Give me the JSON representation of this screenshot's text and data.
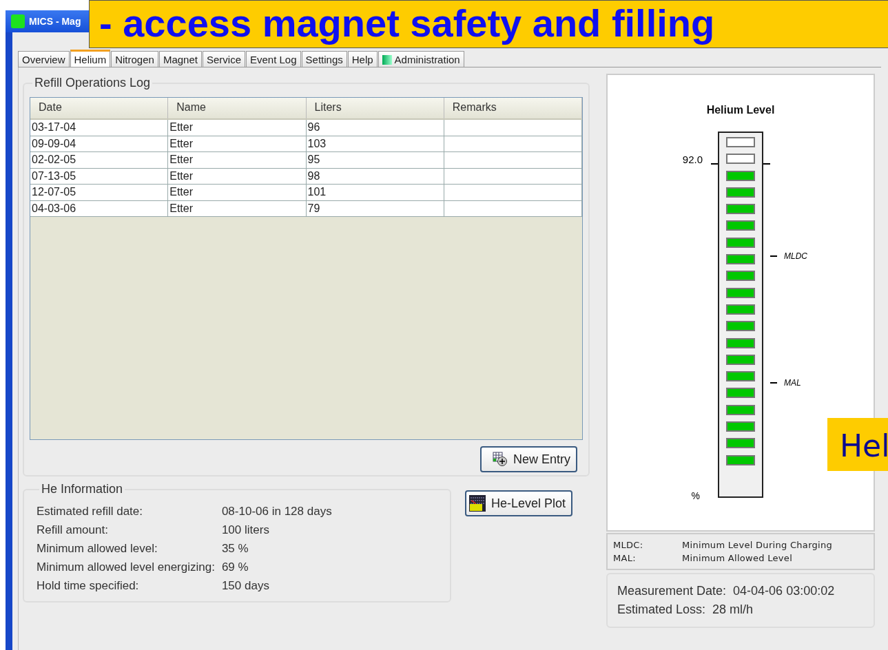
{
  "window": {
    "title": "MICS - Mag"
  },
  "banners": [
    {
      "text": "- access magnet safety and filling",
      "kind": "title"
    },
    {
      "text": "Hel",
      "kind": "callout"
    }
  ],
  "tabs": [
    {
      "label": "Overview",
      "selected": false
    },
    {
      "label": "Helium",
      "selected": true
    },
    {
      "label": "Nitrogen",
      "selected": false
    },
    {
      "label": "Magnet",
      "selected": false
    },
    {
      "label": "Service",
      "selected": false
    },
    {
      "label": "Event Log",
      "selected": false
    },
    {
      "label": "Settings",
      "selected": false
    },
    {
      "label": "Help",
      "selected": false
    },
    {
      "label": "Administration",
      "selected": false
    }
  ],
  "refill_log": {
    "title": "Refill Operations Log",
    "columns": [
      "Date",
      "Name",
      "Liters",
      "Remarks"
    ],
    "rows": [
      [
        "03-17-04",
        "Etter",
        "96",
        ""
      ],
      [
        "09-09-04",
        "Etter",
        "103",
        ""
      ],
      [
        "02-02-05",
        "Etter",
        "95",
        ""
      ],
      [
        "07-13-05",
        "Etter",
        "98",
        ""
      ],
      [
        "12-07-05",
        "Etter",
        "101",
        ""
      ],
      [
        "04-03-06",
        "Etter",
        "79",
        ""
      ]
    ],
    "button": "New Entry"
  },
  "he_information": {
    "title": "He Information",
    "fields": [
      {
        "label": "Estimated refill date:",
        "value": "08-10-06 in 128 days"
      },
      {
        "label": "Refill amount:",
        "value": "100 liters"
      },
      {
        "label": "Minimum allowed level:",
        "value": "35 %"
      },
      {
        "label": "Minimum allowed level energizing:",
        "value": "69 %"
      },
      {
        "label": "Hold time specified:",
        "value": "150 days"
      }
    ]
  },
  "plot_button": "He-Level Plot",
  "helium_level": {
    "title": "Helium Level",
    "level": 0.9,
    "reading": "92.0",
    "unit": "%",
    "marks": [
      {
        "label": "MLDC"
      },
      {
        "label": "MAL"
      }
    ]
  },
  "legend": [
    {
      "abbr": "MLDC:",
      "text": "Minimum Level During Charging"
    },
    {
      "abbr": "MAL:",
      "text": "Minimum Allowed Level"
    }
  ],
  "measurement": {
    "date_label": "Measurement Date:",
    "date": "04-04-06  03:00:02",
    "loss_label": "Estimated Loss:",
    "loss": "28 ml/h"
  }
}
